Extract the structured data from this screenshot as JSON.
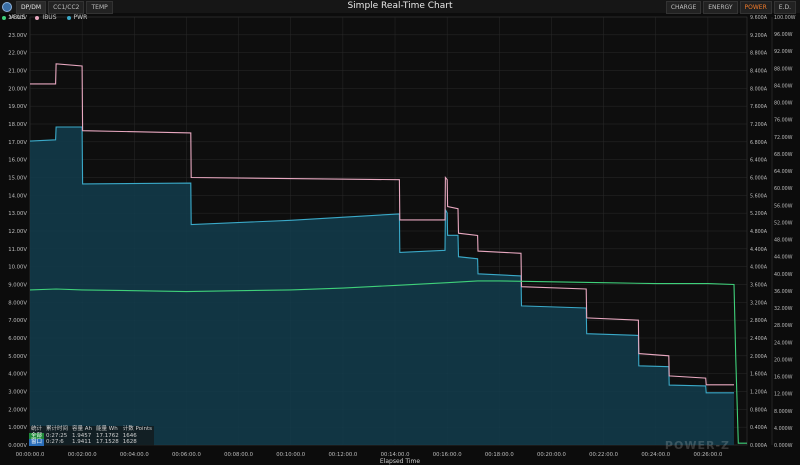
{
  "window": {
    "title": "Simple Real-Time Chart",
    "tabs_left": [
      "DP/DM",
      "CC1/CC2",
      "TEMP"
    ],
    "tabs_right": [
      "CHARGE",
      "ENERGY",
      "POWER",
      "E.D."
    ],
    "active_right_tab": "POWER"
  },
  "watermark": "POWER-Z",
  "stats": {
    "headers": [
      "统计",
      "累计时间",
      "容量 Ah",
      "能量 Wh",
      "计数 Points"
    ],
    "rows": [
      {
        "label": "全部",
        "time": "0:27:25",
        "ah": "1.9457",
        "wh": "17.1762",
        "points": "1646"
      },
      {
        "label": "窗口",
        "time": "0:27:6",
        "ah": "1.9411",
        "wh": "17.1528",
        "points": "1628"
      }
    ]
  },
  "colors": {
    "vbus": "#3fd07a",
    "ibus": "#e8a8c0",
    "pwr": "#3aa9c8",
    "pwr_fill": "#123c4c",
    "accent": "#f07a2a",
    "grid": "#2a2a2a"
  },
  "chart_data": {
    "type": "line",
    "title": "Simple Real-Time Chart",
    "xlabel": "Elapsed Time",
    "x_unit": "seconds",
    "xlim": [
      0,
      1650
    ],
    "x_ticks": [
      0,
      120,
      240,
      360,
      480,
      600,
      720,
      840,
      960,
      1080,
      1200,
      1320,
      1440,
      1560
    ],
    "x_tick_labels": [
      "00:00:00.0",
      "00:02:00.0",
      "00:04:00.0",
      "00:06:00.0",
      "00:08:00.0",
      "00:10:00.0",
      "00:12:00.0",
      "00:14:00.0",
      "00:16:00.0",
      "00:18:00.0",
      "00:20:00.0",
      "00:22:00.0",
      "00:24:00.0",
      "00:26:00.0"
    ],
    "left_axis": {
      "unit": "V",
      "ylim": [
        0,
        24
      ],
      "ticks": [
        0,
        1,
        2,
        3,
        4,
        5,
        6,
        7,
        8,
        9,
        10,
        11,
        12,
        13,
        14,
        15,
        16,
        17,
        18,
        19,
        20,
        21,
        22,
        23,
        24
      ],
      "tick_labels": [
        "0.000V",
        "1.000V",
        "2.000V",
        "3.000V",
        "4.000V",
        "5.000V",
        "6.000V",
        "7.000V",
        "8.000V",
        "9.000V",
        "10.00V",
        "11.00V",
        "12.00V",
        "13.00V",
        "14.00V",
        "15.00V",
        "16.00V",
        "17.00V",
        "18.00V",
        "19.00V",
        "20.00V",
        "21.00V",
        "22.00V",
        "23.00V",
        "24.00V"
      ]
    },
    "right_axis_current": {
      "unit": "A",
      "ylim": [
        0,
        9.6
      ],
      "ticks": [
        0,
        0.4,
        0.8,
        1.2,
        1.6,
        2.0,
        2.4,
        2.8,
        3.2,
        3.6,
        4.0,
        4.4,
        4.8,
        5.2,
        5.6,
        6.0,
        6.4,
        6.8,
        7.2,
        7.6,
        8.0,
        8.4,
        8.8,
        9.2,
        9.6
      ],
      "tick_labels": [
        "0.000A",
        "0.400A",
        "0.800A",
        "1.200A",
        "1.600A",
        "2.000A",
        "2.400A",
        "2.800A",
        "3.200A",
        "3.600A",
        "4.000A",
        "4.400A",
        "4.800A",
        "5.200A",
        "5.600A",
        "6.000A",
        "6.400A",
        "6.800A",
        "7.200A",
        "7.600A",
        "8.000A",
        "8.400A",
        "8.800A",
        "9.200A",
        "9.600A"
      ]
    },
    "right_axis_power": {
      "unit": "W",
      "ylim": [
        0,
        100
      ],
      "ticks": [
        0,
        4,
        8,
        12,
        16,
        20,
        24,
        28,
        32,
        36,
        40,
        44,
        48,
        52,
        56,
        60,
        64,
        68,
        72,
        76,
        80,
        84,
        88,
        92,
        96,
        100
      ],
      "tick_labels": [
        "0.000W",
        "4.000W",
        "8.000W",
        "12.00W",
        "16.00W",
        "20.00W",
        "24.00W",
        "28.00W",
        "32.00W",
        "36.00W",
        "40.00W",
        "44.00W",
        "48.00W",
        "52.00W",
        "56.00W",
        "60.00W",
        "64.00W",
        "68.00W",
        "72.00W",
        "76.00W",
        "80.00W",
        "84.00W",
        "88.00W",
        "92.00W",
        "96.00W",
        "100.00W"
      ]
    },
    "legend_position": "top-left",
    "grid": true,
    "series": [
      {
        "name": "VBUS",
        "axis": "left",
        "x": [
          0,
          60,
          120,
          240,
          360,
          480,
          600,
          720,
          840,
          960,
          1030,
          1080,
          1200,
          1320,
          1440,
          1560,
          1620,
          1624,
          1630,
          1650
        ],
        "values": [
          8.7,
          8.75,
          8.7,
          8.65,
          8.6,
          8.65,
          8.7,
          8.8,
          8.95,
          9.1,
          9.2,
          9.2,
          9.15,
          9.1,
          9.05,
          9.05,
          9.0,
          5.0,
          0.1,
          0.1
        ]
      },
      {
        "name": "IBUS",
        "axis": "right_current",
        "x": [
          0,
          59,
          60,
          120,
          121,
          370,
          371,
          850,
          851,
          955,
          956,
          960,
          961,
          985,
          986,
          1030,
          1031,
          1130,
          1131,
          1280,
          1281,
          1400,
          1401,
          1470,
          1471,
          1555,
          1556,
          1620
        ],
        "values": [
          8.1,
          8.1,
          8.55,
          8.5,
          7.05,
          7.0,
          6.0,
          5.95,
          5.05,
          5.05,
          6.0,
          5.95,
          5.35,
          5.3,
          4.75,
          4.7,
          4.35,
          4.3,
          3.55,
          3.5,
          2.85,
          2.8,
          2.05,
          2.0,
          1.55,
          1.5,
          1.35,
          1.35
        ]
      },
      {
        "name": "PWR",
        "axis": "right_power",
        "x": [
          0,
          59,
          60,
          120,
          121,
          370,
          371,
          600,
          850,
          851,
          955,
          956,
          960,
          961,
          985,
          986,
          1030,
          1031,
          1130,
          1131,
          1280,
          1281,
          1400,
          1401,
          1470,
          1471,
          1555,
          1556,
          1620
        ],
        "values": [
          71.0,
          71.3,
          74.3,
          74.3,
          61.0,
          61.2,
          51.5,
          52.5,
          54.0,
          45.0,
          45.5,
          55.0,
          54.2,
          49.0,
          49.0,
          44.0,
          43.5,
          40.0,
          39.5,
          32.5,
          32.0,
          26.0,
          25.6,
          18.5,
          18.3,
          14.0,
          13.8,
          12.2,
          12.2
        ]
      }
    ]
  }
}
